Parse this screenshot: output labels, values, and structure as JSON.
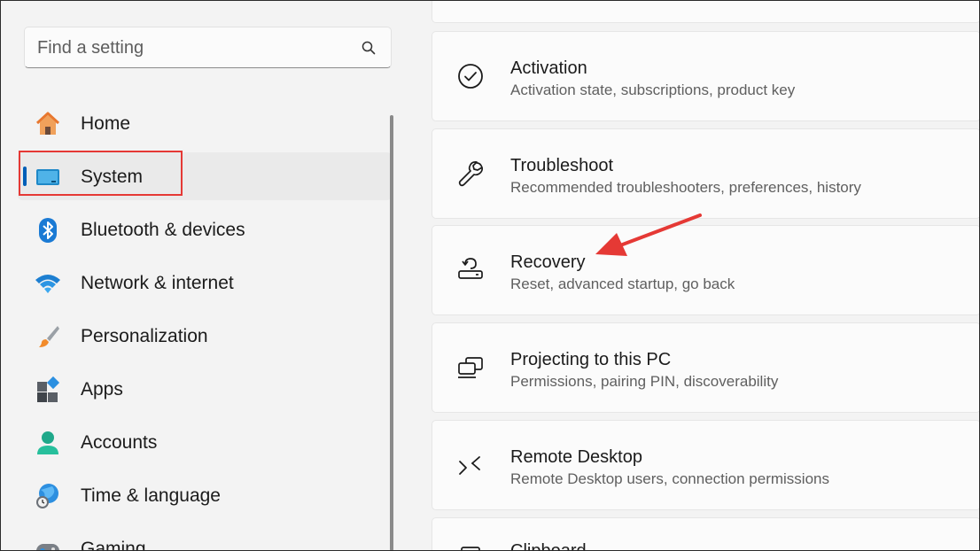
{
  "search": {
    "placeholder": "Find a setting"
  },
  "sidebar": {
    "items": [
      {
        "label": "Home",
        "icon": "home-icon"
      },
      {
        "label": "System",
        "icon": "monitor-icon",
        "selected": true
      },
      {
        "label": "Bluetooth & devices",
        "icon": "bluetooth-icon"
      },
      {
        "label": "Network & internet",
        "icon": "wifi-icon"
      },
      {
        "label": "Personalization",
        "icon": "paintbrush-icon"
      },
      {
        "label": "Apps",
        "icon": "apps-icon"
      },
      {
        "label": "Accounts",
        "icon": "person-icon"
      },
      {
        "label": "Time & language",
        "icon": "globe-clock-icon"
      },
      {
        "label": "Gaming",
        "icon": "gamepad-icon"
      }
    ]
  },
  "cards": [
    {
      "title": "Activation",
      "desc": "Activation state, subscriptions, product key",
      "icon": "check-circle-icon"
    },
    {
      "title": "Troubleshoot",
      "desc": "Recommended troubleshooters, preferences, history",
      "icon": "wrench-icon"
    },
    {
      "title": "Recovery",
      "desc": "Reset, advanced startup, go back",
      "icon": "recovery-icon"
    },
    {
      "title": "Projecting to this PC",
      "desc": "Permissions, pairing PIN, discoverability",
      "icon": "projecting-icon"
    },
    {
      "title": "Remote Desktop",
      "desc": "Remote Desktop users, connection permissions",
      "icon": "remote-desktop-icon"
    },
    {
      "title": "Clipboard",
      "desc": "",
      "icon": "clipboard-icon"
    }
  ],
  "colors": {
    "accent": "#005fb8",
    "annotation": "#e53935"
  }
}
